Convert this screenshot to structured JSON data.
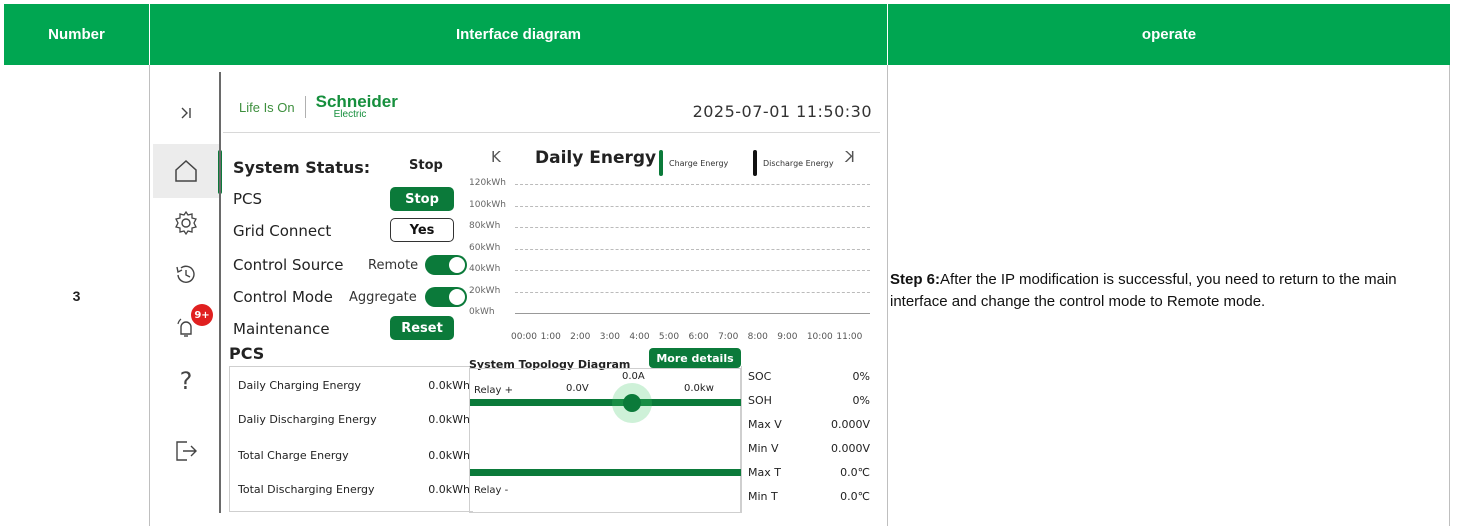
{
  "table": {
    "headers": [
      "Number",
      "Interface diagram",
      "operate"
    ],
    "row": {
      "number": "3",
      "operate_bold": "Step 6:",
      "operate_text": "After the IP modification is successful, you need to return to the main interface and change the control mode to Remote mode."
    }
  },
  "screen": {
    "sidebar": {
      "items": [
        {
          "name": "collapse",
          "icon": "collapse-icon"
        },
        {
          "name": "home",
          "icon": "home-icon",
          "active": true
        },
        {
          "name": "settings",
          "icon": "gear-icon"
        },
        {
          "name": "history",
          "icon": "history-icon"
        },
        {
          "name": "alarms",
          "icon": "bell-icon",
          "badge": "9+"
        },
        {
          "name": "help",
          "icon": "question-icon"
        },
        {
          "name": "logout",
          "icon": "logout-icon"
        }
      ],
      "collapse_glyph": "⟩|",
      "help_glyph": "?"
    },
    "brand": {
      "tagline": "Life Is On",
      "name": "Schneider",
      "sub": "Electric"
    },
    "datetime": "2025-07-01 11:50:30",
    "status": {
      "title": "System Status:",
      "value": "Stop",
      "pcs_label": "PCS",
      "pcs_button": "Stop",
      "grid_label": "Grid Connect",
      "grid_button": "Yes",
      "control_source_label": "Control Source",
      "control_source_value": "Remote",
      "control_mode_label": "Control Mode",
      "control_mode_value": "Aggregate",
      "maintenance_label": "Maintenance",
      "maintenance_button": "Reset",
      "toggles": {
        "control_source_on": true,
        "control_mode_on": true
      }
    },
    "chart_nav": {
      "prev": "K",
      "next": "K"
    },
    "chart_data": {
      "type": "bar",
      "title": "Daily Energy",
      "categories": [
        "00:00",
        "1:00",
        "2:00",
        "3:00",
        "4:00",
        "5:00",
        "6:00",
        "7:00",
        "8:00",
        "9:00",
        "10:00",
        "11:00"
      ],
      "y_ticks": [
        "120kWh",
        "100kWh",
        "80kWh",
        "60kWh",
        "40kWh",
        "20kWh",
        "0kWh"
      ],
      "ylim": [
        0,
        120
      ],
      "series": [
        {
          "name": "Charge Energy",
          "color": "#0b7a3a",
          "values": [
            0,
            0,
            0,
            0,
            0,
            0,
            0,
            0,
            0,
            0,
            0,
            0
          ]
        },
        {
          "name": "Discharge Energy",
          "color": "#111111",
          "values": [
            0,
            0,
            0,
            0,
            0,
            0,
            0,
            0,
            0,
            0,
            0,
            0
          ]
        }
      ],
      "grid": true
    },
    "pcs": {
      "title": "PCS",
      "rows": [
        {
          "label": "Daily Charging Energy",
          "value": "0.0kWh"
        },
        {
          "label": "Daliy Discharging Energy",
          "value": "0.0kWh"
        },
        {
          "label": "Total Charge Energy",
          "value": "0.0kWh"
        },
        {
          "label": "Total Discharging Energy",
          "value": "0.0kWh"
        }
      ]
    },
    "topology": {
      "title": "System Topology Diagram",
      "more_button": "More details",
      "relay_plus": "Relay +",
      "relay_minus": "Relay -",
      "voltage": "0.0V",
      "current": "0.0A",
      "power": "0.0kw"
    },
    "bms": {
      "rows": [
        {
          "label": "SOC",
          "value": "0%"
        },
        {
          "label": "SOH",
          "value": "0%"
        },
        {
          "label": "Max V",
          "value": "0.000V"
        },
        {
          "label": "Min V",
          "value": "0.000V"
        },
        {
          "label": "Max T",
          "value": "0.0℃"
        },
        {
          "label": "Min T",
          "value": "0.0℃"
        }
      ]
    },
    "colors": {
      "header_green": "#00a651",
      "accent": "#0b7a3a",
      "badge": "#e02020"
    }
  }
}
